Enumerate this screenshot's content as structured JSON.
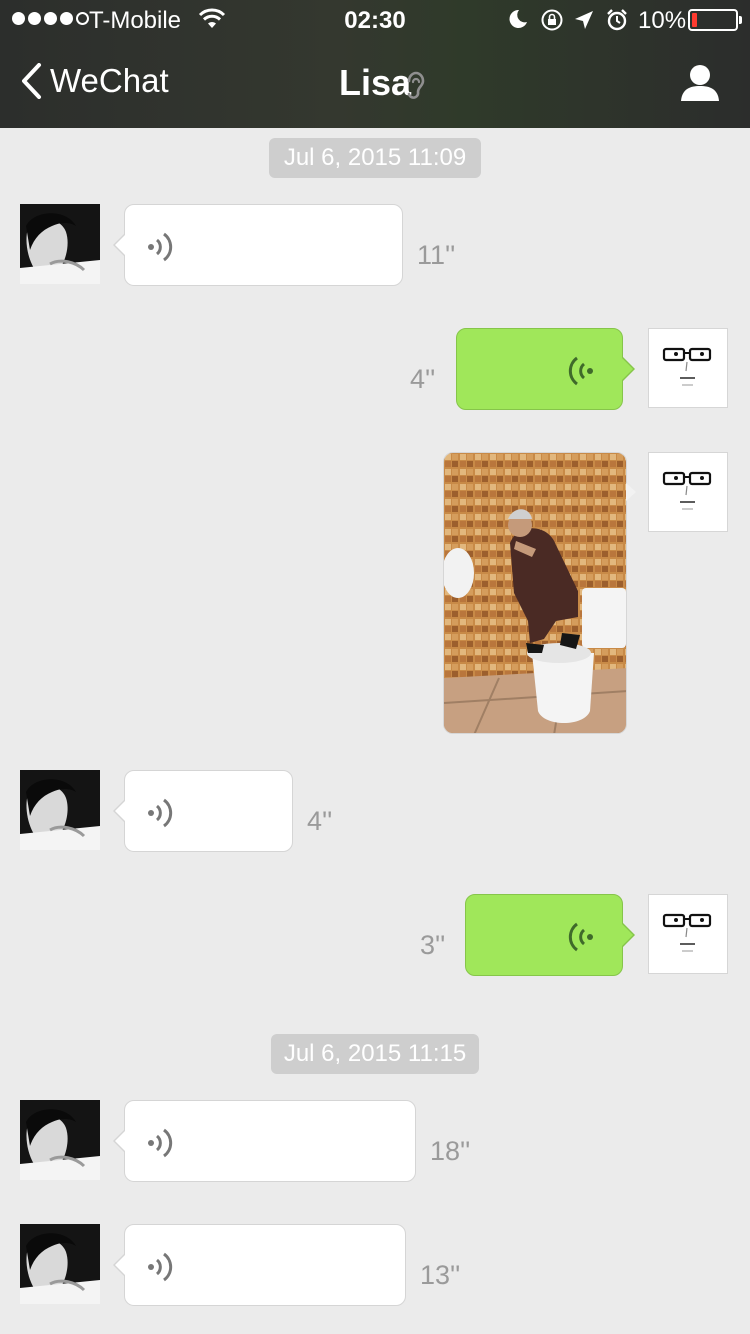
{
  "status_bar": {
    "carrier": "T-Mobile",
    "time": "02:30",
    "battery": "10%",
    "icons": [
      "signal-dots",
      "wifi-icon",
      "moon-icon",
      "rotation-lock-icon",
      "location-icon",
      "alarm-icon",
      "battery-icon"
    ]
  },
  "nav": {
    "back_label": "WeChat",
    "title": "Lisa",
    "icons": [
      "chevron-left-icon",
      "ear-icon",
      "profile-icon"
    ]
  },
  "colors": {
    "nav_bg": "#2c2e2c",
    "chat_bg": "#ebebeb",
    "outgoing_bubble": "#a0e75a",
    "incoming_bubble": "#ffffff",
    "timestamp_chip": "#cecece",
    "duration_text": "#9a9a9a"
  },
  "timestamps": [
    "Jul 6, 2015 11:09",
    "Jul 6, 2015 11:15"
  ],
  "messages": [
    {
      "sender": "Lisa",
      "type": "voice",
      "duration": "11''"
    },
    {
      "sender": "me",
      "type": "voice",
      "duration": "4''"
    },
    {
      "sender": "me",
      "type": "image",
      "description_icon": "photo-thumbnail"
    },
    {
      "sender": "Lisa",
      "type": "voice",
      "duration": "4''"
    },
    {
      "sender": "me",
      "type": "voice",
      "duration": "3''"
    },
    {
      "sender": "Lisa",
      "type": "voice",
      "duration": "18''"
    },
    {
      "sender": "Lisa",
      "type": "voice",
      "duration": "13''"
    }
  ]
}
